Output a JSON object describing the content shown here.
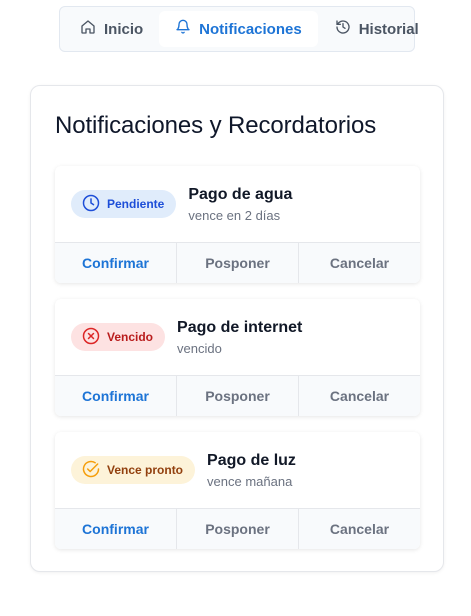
{
  "nav": {
    "tabs": [
      {
        "label": "Inicio",
        "icon": "home-icon"
      },
      {
        "label": "Notificaciones",
        "icon": "bell-icon",
        "active": true
      },
      {
        "label": "Historial",
        "icon": "history-icon"
      }
    ]
  },
  "panel": {
    "title": "Notificaciones y Recordatorios",
    "cards": [
      {
        "badge": "Pendiente",
        "badge_icon": "clock-icon",
        "title": "Pago de agua",
        "subtitle": "vence en 2 días"
      },
      {
        "badge": "Vencido",
        "badge_icon": "x-circle-icon",
        "title": "Pago de internet",
        "subtitle": "vencido"
      },
      {
        "badge": "Vence pronto",
        "badge_icon": "check-circle-icon",
        "title": "Pago de luz",
        "subtitle": "vence mañana"
      }
    ],
    "actions": {
      "confirm": "Confirmar",
      "postpone": "Posponer",
      "cancel": "Cancelar"
    }
  },
  "colors": {
    "accent": "#1d74d6",
    "pending_bg": "#e0ecfb",
    "overdue_bg": "#fde2e2",
    "soon_bg": "#fdf3d9"
  }
}
